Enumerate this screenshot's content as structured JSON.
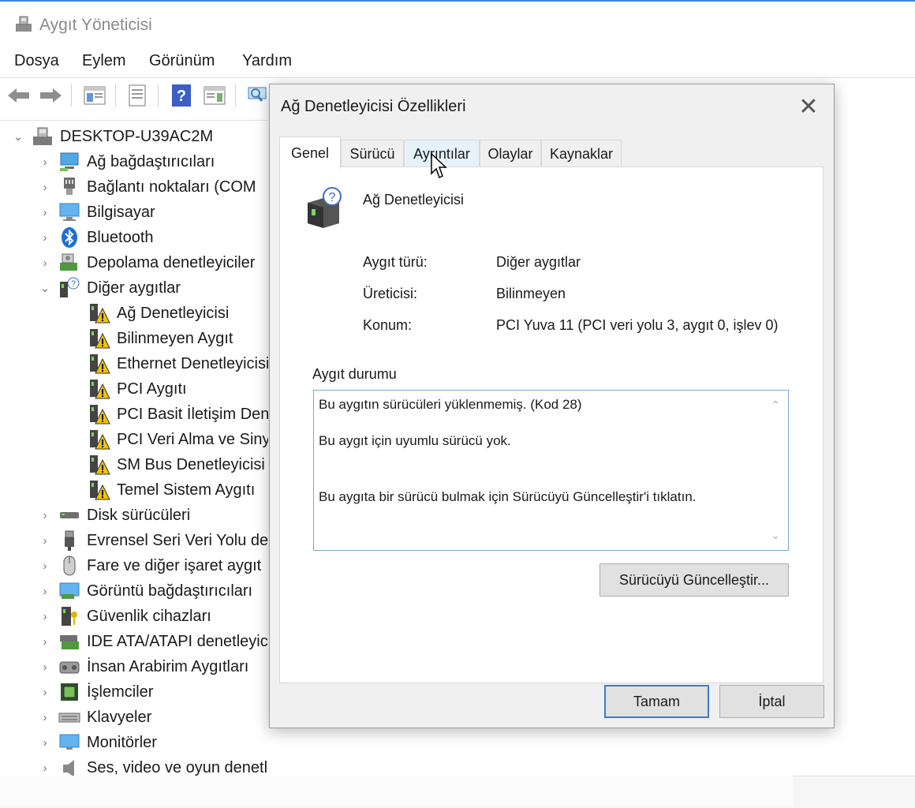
{
  "window": {
    "title": "Aygıt Yöneticisi",
    "icon": "device-manager-icon"
  },
  "menu": [
    "Dosya",
    "Eylem",
    "Görünüm",
    "Yardım"
  ],
  "tree": {
    "root": "DESKTOP-U39AC2M",
    "items": [
      {
        "label": "Ağ bağdaştırıcıları",
        "icon": "network-adapter-icon",
        "expanded": false
      },
      {
        "label": "Bağlantı noktaları (COM",
        "icon": "port-icon",
        "expanded": false
      },
      {
        "label": "Bilgisayar",
        "icon": "computer-icon",
        "expanded": false
      },
      {
        "label": "Bluetooth",
        "icon": "bluetooth-icon",
        "expanded": false
      },
      {
        "label": "Depolama denetleyiciler",
        "icon": "storage-controller-icon",
        "expanded": false
      },
      {
        "label": "Diğer aygıtlar",
        "icon": "unknown-device-icon",
        "expanded": true
      },
      {
        "label": "Disk sürücüleri",
        "icon": "disk-drive-icon",
        "expanded": false
      },
      {
        "label": "Evrensel Seri Veri Yolu de",
        "icon": "usb-icon",
        "expanded": false
      },
      {
        "label": "Fare ve diğer işaret aygıt",
        "icon": "mouse-icon",
        "expanded": false
      },
      {
        "label": "Görüntü bağdaştırıcıları",
        "icon": "display-adapter-icon",
        "expanded": false
      },
      {
        "label": "Güvenlik cihazları",
        "icon": "security-device-icon",
        "expanded": false
      },
      {
        "label": "IDE ATA/ATAPI denetleyic",
        "icon": "ide-controller-icon",
        "expanded": false
      },
      {
        "label": "İnsan Arabirim Aygıtları",
        "icon": "hid-icon",
        "expanded": false
      },
      {
        "label": "İşlemciler",
        "icon": "processor-icon",
        "expanded": false
      },
      {
        "label": "Klavyeler",
        "icon": "keyboard-icon",
        "expanded": false
      },
      {
        "label": "Monitörler",
        "icon": "monitor-icon",
        "expanded": false
      },
      {
        "label": "Ses, video ve oyun denetleyicileri",
        "icon": "sound-icon",
        "expanded": false
      }
    ],
    "other_devices": [
      "Ağ Denetleyicisi",
      "Bilinmeyen Aygıt",
      "Ethernet Denetleyicisi",
      "PCI Aygıtı",
      "PCI Basit İletişim Den",
      "PCI Veri Alma ve Siny",
      "SM Bus Denetleyicisi",
      "Temel Sistem Aygıtı"
    ]
  },
  "dialog": {
    "title": "Ağ Denetleyicisi Özellikleri",
    "tabs": [
      "Genel",
      "Sürücü",
      "Ayrıntılar",
      "Olaylar",
      "Kaynaklar"
    ],
    "active_tab": "Genel",
    "device_name": "Ağ Denetleyicisi",
    "properties": [
      {
        "label": "Aygıt türü:",
        "value": "Diğer aygıtlar"
      },
      {
        "label": "Üreticisi:",
        "value": "Bilinmeyen"
      },
      {
        "label": "Konum:",
        "value": "PCI Yuva 11 (PCI veri yolu 3, aygıt 0, işlev 0)"
      }
    ],
    "status_group": "Aygıt durumu",
    "status_lines": [
      "Bu aygıtın sürücüleri yüklenmemiş. (Kod 28)",
      "Bu aygıt için uyumlu sürücü yok.",
      "Bu aygıta bir sürücü bulmak için Sürücüyü Güncelleştir'i tıklatın."
    ],
    "update_button": "Sürücüyü Güncelleştir...",
    "ok_button": "Tamam",
    "cancel_button": "İptal"
  },
  "colors": {
    "accent": "#3a7bd5",
    "warning": "#f2c200",
    "title_gray": "#8a8a8a"
  }
}
